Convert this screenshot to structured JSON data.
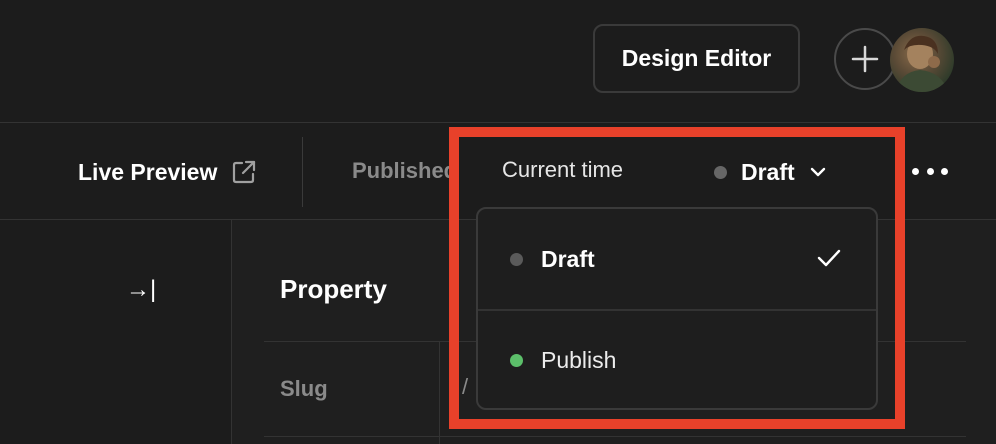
{
  "header": {
    "design_editor_label": "Design Editor",
    "add_icon": "plus-icon",
    "avatar_icon": "user-avatar"
  },
  "toolbar": {
    "live_preview_label": "Live Preview",
    "external_link_icon": "external-link-icon",
    "published_label": "Published",
    "current_time_label": "Current time",
    "version_selected": "Draft",
    "version_dot_color": "#666666",
    "more_icon": "more-horizontal-icon"
  },
  "dropdown": {
    "options": [
      {
        "label": "Draft",
        "dot_color": "#5a5a5a",
        "selected": true
      },
      {
        "label": "Publish",
        "dot_color": "#5cbf6a",
        "selected": false
      }
    ]
  },
  "sidebar": {
    "collapse_icon": "collapse-right-icon",
    "collapse_glyph": "→|"
  },
  "main": {
    "section_title": "Property",
    "fields": [
      {
        "label": "Slug",
        "value": "/"
      }
    ]
  },
  "colors": {
    "background": "#1c1c1c",
    "highlight": "#e8412a",
    "publish_green": "#5cbf6a"
  }
}
